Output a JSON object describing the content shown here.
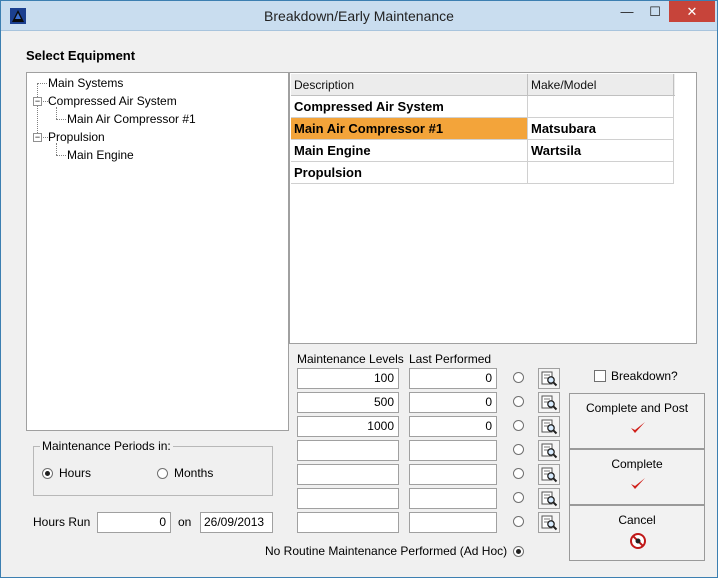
{
  "window": {
    "title": "Breakdown/Early Maintenance",
    "minimize_glyph": "—",
    "maximize_glyph": "☐",
    "close_glyph": "✕"
  },
  "section": {
    "select_equipment": "Select Equipment"
  },
  "tree": {
    "nodes": [
      {
        "label": "Main Systems"
      },
      {
        "label": "Compressed Air System"
      },
      {
        "label": "Main Air Compressor #1"
      },
      {
        "label": "Propulsion"
      },
      {
        "label": "Main Engine"
      }
    ],
    "expander_glyph": "−"
  },
  "grid": {
    "columns": [
      "Description",
      "Make/Model"
    ],
    "rows": [
      {
        "description": "Compressed Air System",
        "make_model": ""
      },
      {
        "description": "Main Air Compressor #1",
        "make_model": "Matsubara",
        "selected": true
      },
      {
        "description": "Main Engine",
        "make_model": "Wartsila"
      },
      {
        "description": "Propulsion",
        "make_model": ""
      }
    ]
  },
  "maintenance": {
    "levels_header": "Maintenance Levels",
    "last_performed_header": "Last Performed",
    "rows": [
      {
        "level": "100",
        "last": "0"
      },
      {
        "level": "500",
        "last": "0"
      },
      {
        "level": "1000",
        "last": "0"
      },
      {
        "level": "",
        "last": ""
      },
      {
        "level": "",
        "last": ""
      },
      {
        "level": "",
        "last": ""
      },
      {
        "level": "",
        "last": ""
      }
    ],
    "ad_hoc_label": "No Routine Maintenance Performed (Ad Hoc)",
    "ad_hoc_selected": true
  },
  "breakdown": {
    "label": "Breakdown?",
    "checked": false
  },
  "buttons": {
    "complete_post": "Complete and Post",
    "complete": "Complete",
    "cancel": "Cancel"
  },
  "periods": {
    "title": "Maintenance Periods in:",
    "hours": "Hours",
    "months": "Months",
    "selected": "Hours"
  },
  "hours_run": {
    "label": "Hours Run",
    "value": "0",
    "on_label": "on",
    "date": "26/09/2013"
  },
  "colors": {
    "selection": "#f3a43a",
    "check_red": "#d0201a"
  }
}
